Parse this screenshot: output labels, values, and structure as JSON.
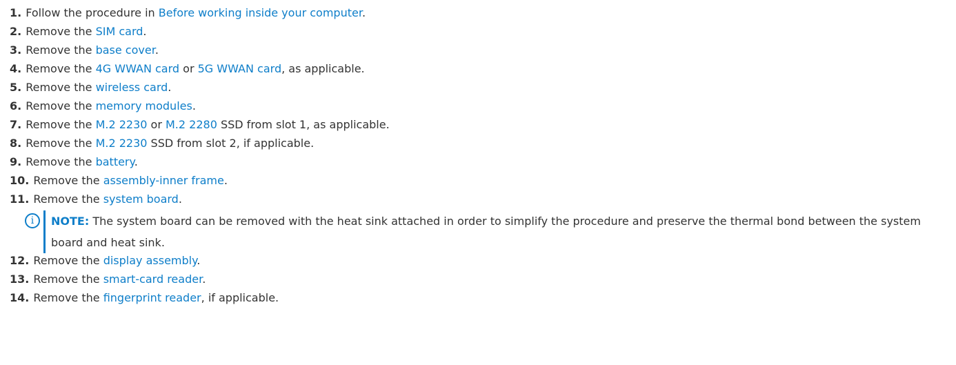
{
  "steps": [
    {
      "num": "1.",
      "parts": [
        {
          "t": "Follow the procedure in "
        },
        {
          "t": "Before working inside your computer",
          "link": true
        },
        {
          "t": "."
        }
      ]
    },
    {
      "num": "2.",
      "parts": [
        {
          "t": "Remove the "
        },
        {
          "t": "SIM card",
          "link": true
        },
        {
          "t": "."
        }
      ]
    },
    {
      "num": "3.",
      "parts": [
        {
          "t": "Remove the "
        },
        {
          "t": "base cover",
          "link": true
        },
        {
          "t": "."
        }
      ]
    },
    {
      "num": "4.",
      "parts": [
        {
          "t": "Remove the "
        },
        {
          "t": "4G WWAN card",
          "link": true
        },
        {
          "t": " or "
        },
        {
          "t": "5G WWAN card",
          "link": true
        },
        {
          "t": ", as applicable."
        }
      ]
    },
    {
      "num": "5.",
      "parts": [
        {
          "t": "Remove the "
        },
        {
          "t": "wireless card",
          "link": true
        },
        {
          "t": "."
        }
      ]
    },
    {
      "num": "6.",
      "parts": [
        {
          "t": "Remove the "
        },
        {
          "t": "memory modules",
          "link": true
        },
        {
          "t": "."
        }
      ]
    },
    {
      "num": "7.",
      "parts": [
        {
          "t": "Remove the "
        },
        {
          "t": "M.2 2230",
          "link": true
        },
        {
          "t": " or "
        },
        {
          "t": "M.2 2280",
          "link": true
        },
        {
          "t": " SSD from slot 1, as applicable."
        }
      ]
    },
    {
      "num": "8.",
      "parts": [
        {
          "t": "Remove the "
        },
        {
          "t": "M.2 2230",
          "link": true
        },
        {
          "t": " SSD from slot 2, if applicable."
        }
      ]
    },
    {
      "num": "9.",
      "parts": [
        {
          "t": "Remove the "
        },
        {
          "t": "battery",
          "link": true
        },
        {
          "t": "."
        }
      ]
    },
    {
      "num": "10.",
      "parts": [
        {
          "t": "Remove the "
        },
        {
          "t": "assembly-inner frame",
          "link": true
        },
        {
          "t": "."
        }
      ]
    },
    {
      "num": "11.",
      "parts": [
        {
          "t": "Remove the "
        },
        {
          "t": "system board",
          "link": true
        },
        {
          "t": "."
        }
      ],
      "note": {
        "icon": "info-circle-icon",
        "label": "NOTE:",
        "text": " The system board can be removed with the heat sink attached in order to simplify the procedure and preserve the thermal bond between the system board and heat sink."
      }
    },
    {
      "num": "12.",
      "parts": [
        {
          "t": "Remove the "
        },
        {
          "t": "display assembly",
          "link": true
        },
        {
          "t": "."
        }
      ]
    },
    {
      "num": "13.",
      "parts": [
        {
          "t": "Remove the "
        },
        {
          "t": "smart-card reader",
          "link": true
        },
        {
          "t": "."
        }
      ]
    },
    {
      "num": "14.",
      "parts": [
        {
          "t": "Remove the "
        },
        {
          "t": "fingerprint reader",
          "link": true
        },
        {
          "t": ", if applicable."
        }
      ]
    }
  ],
  "colors": {
    "link": "#0e7ec9",
    "text": "#333333",
    "note_accent": "#0e7ec9"
  }
}
